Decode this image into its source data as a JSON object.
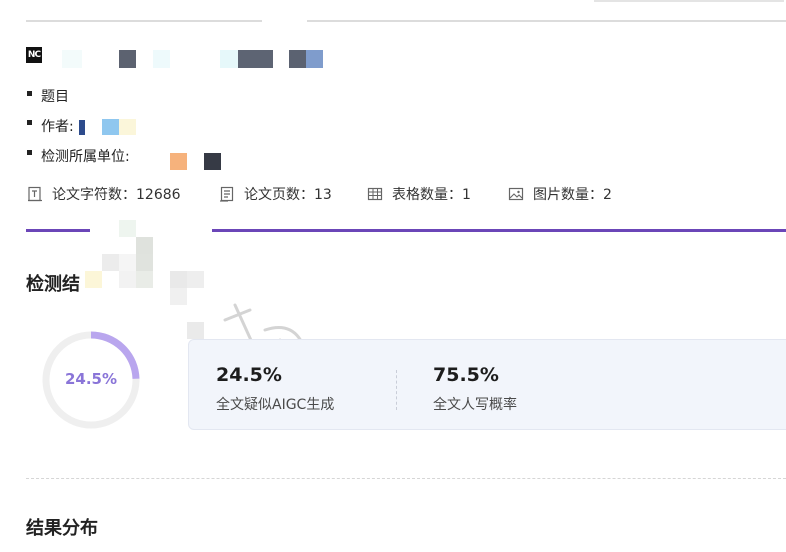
{
  "info": {
    "logo_text": "NC",
    "items": [
      {
        "label": "题目"
      },
      {
        "label": "作者:"
      },
      {
        "label": "检测所属单位:"
      }
    ]
  },
  "stats": [
    {
      "icon": "document-icon",
      "text": "论文字符数：12686"
    },
    {
      "icon": "pages-icon",
      "text": "论文页数：13"
    },
    {
      "icon": "table-icon",
      "text": "表格数量：1"
    },
    {
      "icon": "image-icon",
      "text": "图片数量：2"
    }
  ],
  "result": {
    "title": "检测结",
    "ring_percent": 24.5,
    "ring_label": "24.5%",
    "aigc_value": "24.5%",
    "aigc_label": "全文疑似AIGC生成",
    "human_value": "75.5%",
    "human_label": "全文人写概率"
  },
  "distribution": {
    "title": "结果分布"
  },
  "colors": {
    "accent": "#6b46b8",
    "ring_fill": "#b9a6ee",
    "ring_track": "#efefef",
    "ring_text": "#8a75d8",
    "card_bg": "#f2f5fb"
  }
}
